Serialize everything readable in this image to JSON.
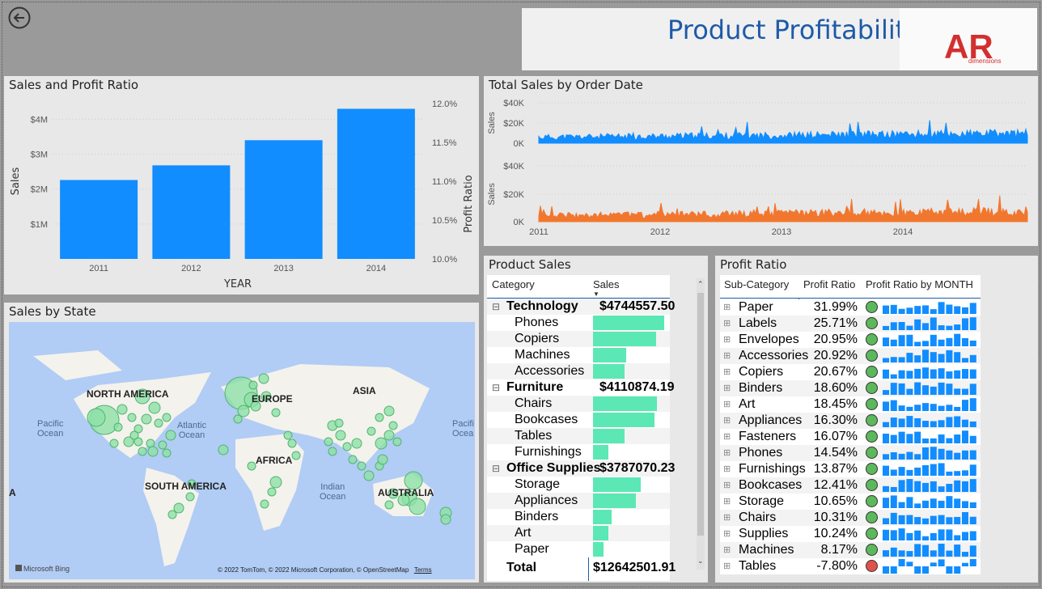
{
  "header": {
    "title": "Product Profitability",
    "logo_text": "AR",
    "logo_sub": "dimensions"
  },
  "sales_profit": {
    "title": "Sales and Profit Ratio",
    "chart_data": {
      "type": "bar",
      "categories": [
        "2011",
        "2012",
        "2013",
        "2014"
      ],
      "values": [
        2.26,
        2.68,
        3.4,
        4.3
      ],
      "ylabel": "Sales",
      "y2label": "Profit Ratio",
      "xlabel": "YEAR",
      "ylim": [
        0,
        4.45
      ],
      "yticks": [
        "$1M",
        "$2M",
        "$3M",
        "$4M"
      ],
      "y2ticks": [
        "10.0%",
        "10.5%",
        "11.0%",
        "11.5%",
        "12.0%"
      ],
      "color": "#118dff"
    }
  },
  "total_sales": {
    "title": "Total Sales by Order Date",
    "top": {
      "ylabel": "Sales",
      "yticks": [
        "$40K",
        "$20K",
        "0K"
      ],
      "color": "#118dff"
    },
    "bottom": {
      "ylabel": "Sales",
      "yticks": [
        "$40K",
        "$20K",
        "0K"
      ],
      "color": "#f2772e"
    },
    "xticks": [
      "2011",
      "2012",
      "2013",
      "2014"
    ]
  },
  "map": {
    "title": "Sales by State",
    "labels": {
      "na": "NORTH AMERICA",
      "sa": "SOUTH AMERICA",
      "eu": "EUROPE",
      "af": "AFRICA",
      "as": "ASIA",
      "au": "AUSTRALIA",
      "pac1": "Pacific",
      "pac1b": "Ocean",
      "atl": "Atlantic",
      "atlb": "Ocean",
      "ind": "Indian",
      "indb": "Ocean",
      "pac2": "Pacifi",
      "pac2b": "Ocea",
      "a": "A"
    },
    "bing": "Microsoft Bing",
    "credits": "© 2022 TomTom, © 2022 Microsoft Corporation, © OpenStreetMap",
    "terms": "Terms"
  },
  "product_sales": {
    "title": "Product Sales",
    "headers": {
      "category": "Category",
      "sales": "Sales"
    },
    "rows": [
      {
        "label": "Technology",
        "group": true,
        "value": "$4744557.50"
      },
      {
        "label": "Phones",
        "bar": 0.98
      },
      {
        "label": "Copiers",
        "bar": 0.87
      },
      {
        "label": "Machines",
        "bar": 0.45
      },
      {
        "label": "Accessories",
        "bar": 0.43
      },
      {
        "label": "Furniture",
        "group": true,
        "value": "$4110874.19"
      },
      {
        "label": "Chairs",
        "bar": 0.88
      },
      {
        "label": "Bookcases",
        "bar": 0.84
      },
      {
        "label": "Tables",
        "bar": 0.43
      },
      {
        "label": "Furnishings",
        "bar": 0.21
      },
      {
        "label": "Office Supplies",
        "group": true,
        "value": "$3787070.23"
      },
      {
        "label": "Storage",
        "bar": 0.65
      },
      {
        "label": "Appliances",
        "bar": 0.59
      },
      {
        "label": "Binders",
        "bar": 0.26
      },
      {
        "label": "Art",
        "bar": 0.21
      },
      {
        "label": "Paper",
        "bar": 0.14
      }
    ],
    "total_label": "Total",
    "total_value": "$12642501.91"
  },
  "profit_ratio": {
    "title": "Profit Ratio",
    "headers": {
      "sub": "Sub-Category",
      "ratio": "Profit Ratio",
      "month": "Profit Ratio by MONTH"
    },
    "rows": [
      {
        "label": "Paper",
        "value": "31.99%",
        "status": "good"
      },
      {
        "label": "Labels",
        "value": "25.71%",
        "status": "good"
      },
      {
        "label": "Envelopes",
        "value": "20.95%",
        "status": "good"
      },
      {
        "label": "Accessories",
        "value": "20.92%",
        "status": "good"
      },
      {
        "label": "Copiers",
        "value": "20.67%",
        "status": "good"
      },
      {
        "label": "Binders",
        "value": "18.60%",
        "status": "good"
      },
      {
        "label": "Art",
        "value": "18.45%",
        "status": "good"
      },
      {
        "label": "Appliances",
        "value": "16.30%",
        "status": "good"
      },
      {
        "label": "Fasteners",
        "value": "16.07%",
        "status": "good"
      },
      {
        "label": "Phones",
        "value": "14.54%",
        "status": "good"
      },
      {
        "label": "Furnishings",
        "value": "13.87%",
        "status": "good"
      },
      {
        "label": "Bookcases",
        "value": "12.41%",
        "status": "good"
      },
      {
        "label": "Storage",
        "value": "10.65%",
        "status": "good"
      },
      {
        "label": "Chairs",
        "value": "10.31%",
        "status": "good"
      },
      {
        "label": "Supplies",
        "value": "10.24%",
        "status": "good"
      },
      {
        "label": "Machines",
        "value": "8.17%",
        "status": "good"
      },
      {
        "label": "Tables",
        "value": "-7.80%",
        "status": "bad"
      }
    ],
    "colors": {
      "good": "#5cb85c",
      "bad": "#e0524d",
      "spark": "#118dff"
    }
  }
}
